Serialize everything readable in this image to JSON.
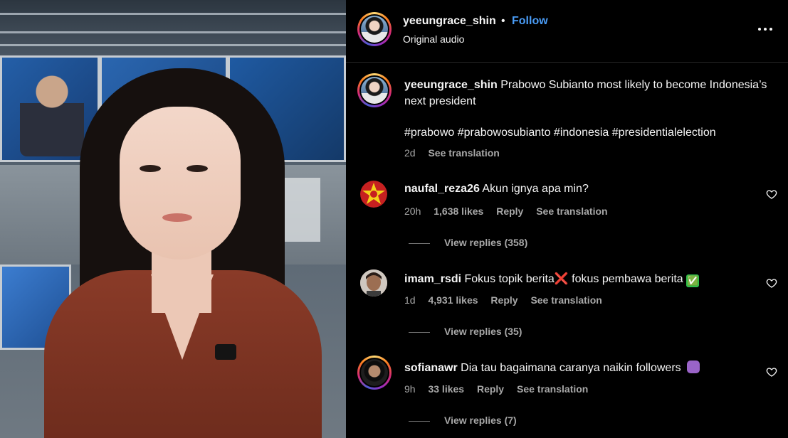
{
  "header": {
    "username": "yeeungrace_shin",
    "separator": "•",
    "follow_label": "Follow",
    "audio_label": "Original audio",
    "more_icon": "more-horizontal-icon"
  },
  "caption": {
    "username": "yeeungrace_shin",
    "text": "Prabowo Subianto most likely to become Indonesia’s next president",
    "hashtags": "#prabowo #prabowosubianto #indonesia #presidentialelection",
    "age": "2d",
    "see_translation": "See translation"
  },
  "comments": [
    {
      "username": "naufal_reza26",
      "text": "Akun ignya apa min?",
      "age": "20h",
      "likes": "1,638 likes",
      "reply": "Reply",
      "see_translation": "See translation",
      "view_replies": "View replies (358)"
    },
    {
      "username": "imam_rsdi",
      "text_before": "Fokus topik berita",
      "emoji_1": "❌",
      "text_after": " fokus pembawa berita ",
      "emoji_2": "✅",
      "age": "1d",
      "likes": "4,931 likes",
      "reply": "Reply",
      "see_translation": "See translation",
      "view_replies": "View replies (35)"
    },
    {
      "username": "sofianawr",
      "text": "Dia tau bagaimana caranya naikin followers",
      "age": "9h",
      "likes": "33 likes",
      "reply": "Reply",
      "see_translation": "See translation",
      "view_replies": "View replies (7)"
    }
  ],
  "colors": {
    "background": "#000000",
    "accent_follow": "#4a9cf6",
    "muted_text": "#a8a8a8"
  }
}
